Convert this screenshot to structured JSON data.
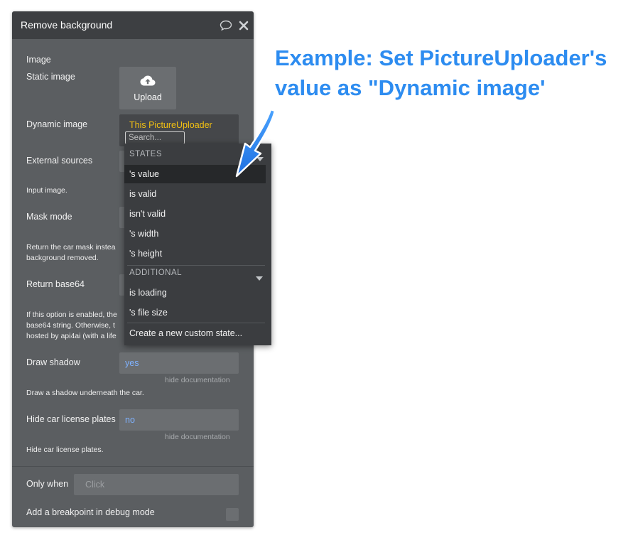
{
  "panel": {
    "title": "Remove background",
    "image_label": "Image",
    "static_image_label": "Static image",
    "upload_label": "Upload",
    "dynamic_image_label": "Dynamic image",
    "dynamic_image_value": "This PictureUploader",
    "search_placeholder": "Search...",
    "external_sources_label": "External sources",
    "input_image_doc": "Input image.",
    "mask_mode_label": "Mask mode",
    "mask_mode_doc": [
      "Return the car mask instea",
      "background removed."
    ],
    "return_base64_label": "Return base64",
    "return_base64_doc": [
      "If this option is enabled, the",
      "base64 string. Otherwise, t",
      "hosted by api4ai (with a life"
    ],
    "draw_shadow_label": "Draw shadow",
    "draw_shadow_value": "yes",
    "draw_shadow_hide_doc": "hide documentation",
    "draw_shadow_doc": "Draw a shadow underneath the car.",
    "hide_plates_label": "Hide car license plates",
    "hide_plates_value": "no",
    "hide_plates_hide_doc": "hide documentation",
    "hide_plates_doc": "Hide car license plates.",
    "only_when_label": "Only when",
    "only_when_placeholder": "Click",
    "breakpoint_label": "Add a breakpoint in debug mode"
  },
  "dropdown": {
    "states_header": "STATES",
    "states": [
      "'s value",
      "is valid",
      "isn't valid",
      "'s width",
      "'s height"
    ],
    "additional_header": "ADDITIONAL",
    "additional": [
      "is loading",
      "'s file size"
    ],
    "create_state": "Create a new custom state..."
  },
  "annotation": {
    "line1": "Example: Set PictureUploader's",
    "line2": "value as \"Dynamic image'"
  },
  "colors": {
    "panel_bg": "#5b5e61",
    "header_bg": "#3d3f42",
    "value_blue": "#7fb2ff",
    "dynamic_yellow": "#f2c012",
    "annotation_blue": "#2d8cf0"
  }
}
